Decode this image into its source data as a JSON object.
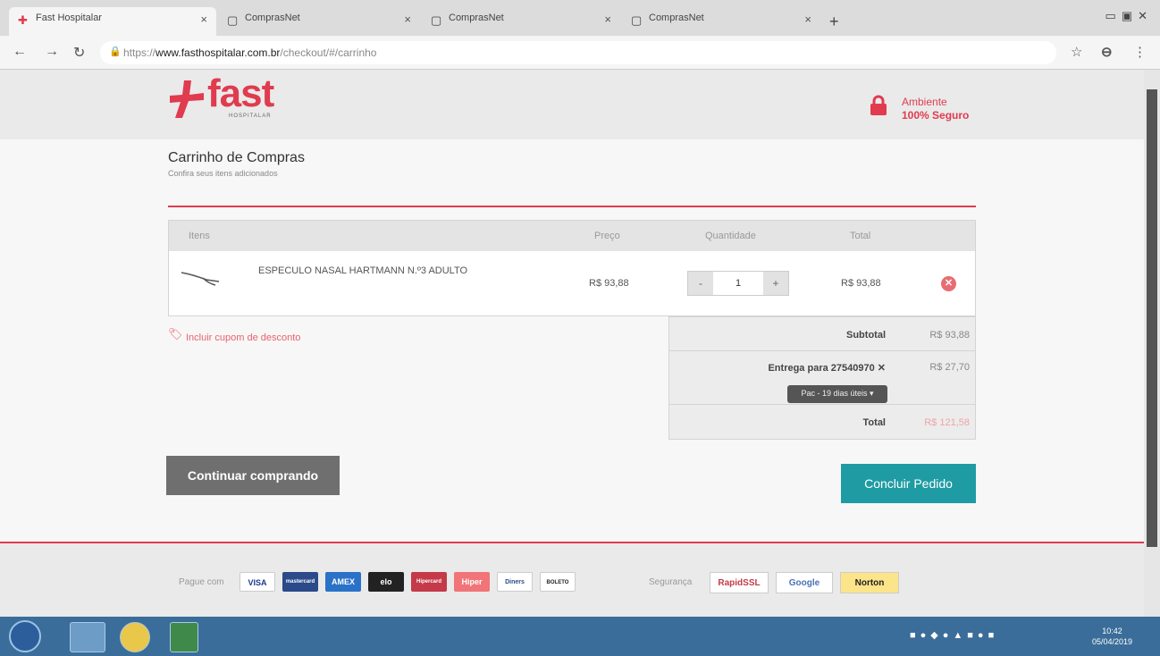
{
  "browser": {
    "tabs": [
      {
        "title": "Fast Hospitalar",
        "active": true
      },
      {
        "title": "ComprasNet",
        "active": false
      },
      {
        "title": "ComprasNet",
        "active": false
      },
      {
        "title": "ComprasNet",
        "active": false
      }
    ],
    "new_tab": "+",
    "url_scheme": "https://",
    "url_host": "www.fasthospitalar.com.br",
    "url_path": "/checkout/#/carrinho"
  },
  "header": {
    "logo_text": "fast",
    "logo_sub": "HOSPITALAR",
    "secure_line1": "Ambiente",
    "secure_line2": "100% Seguro",
    "accent_color": "#e03b4f"
  },
  "cart": {
    "title": "Carrinho de Compras",
    "subtitle": "Confira seus itens adicionados",
    "columns": [
      "Itens",
      "Preço",
      "Quantidade",
      "Total"
    ],
    "items": [
      {
        "name": "ESPECULO NASAL HARTMANN N.º3 ADULTO",
        "price": "R$ 93,88",
        "quantity": "1",
        "total": "R$ 93,88"
      }
    ],
    "qty_minus": "-",
    "qty_plus": "+",
    "remove_glyph": "✕",
    "coupon_label": "Incluir cupom de desconto"
  },
  "summary": {
    "subtotal_label": "Subtotal",
    "subtotal_value": "R$ 93,88",
    "shipping_label": "Entrega para 27540970 ✕",
    "shipping_value": "R$ 27,70",
    "shipping_option": "Pac - 19 dias úteis ▾",
    "total_label": "Total",
    "total_value": "R$ 121,58"
  },
  "actions": {
    "continue_label": "Continuar comprando",
    "finish_label": "Concluir Pedido"
  },
  "footer": {
    "pay_label": "Pague com",
    "payment_methods": [
      "VISA",
      "mastercard",
      "AMEX",
      "elo",
      "Hipercard",
      "Hiper",
      "Diners",
      "BOLETO"
    ],
    "security_label": "Segurança",
    "seals": [
      "RapidSSL",
      "Google",
      "Norton"
    ]
  },
  "taskbar": {
    "time": "10:42",
    "date": "05/04/2019"
  }
}
